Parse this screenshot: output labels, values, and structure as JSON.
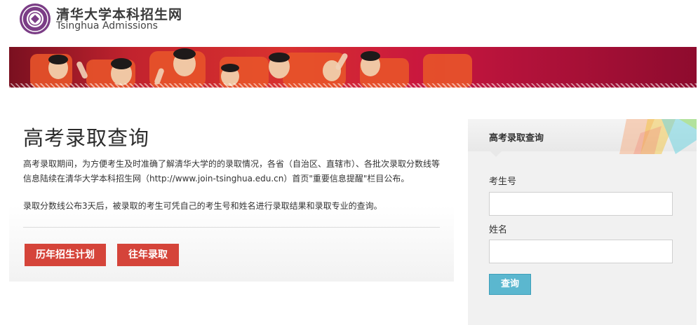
{
  "header": {
    "site_name_cn": "清华大学本科招生网",
    "site_name_en": "Tsinghua Admissions",
    "logo_icon": "tsinghua-seal-icon"
  },
  "banner": {
    "image": "students-cheering-banner",
    "colors": {
      "primary": "#c2232e",
      "dark": "#7a1020"
    }
  },
  "main": {
    "title": "高考录取查询",
    "paragraph1": "高考录取期间，为方便考生及时准确了解清华大学的的录取情况，各省（自治区、直辖市）、各批次录取分数线等信息陆续在清华大学本科招生网（http://www.join-tsinghua.edu.cn）首页\"重要信息提醒\"栏目公布。",
    "paragraph2": "录取分数线公布3天后，被录取的考生可凭自己的考生号和姓名进行录取结果和录取专业的查询。",
    "buttons": {
      "plan_label": "历年招生计划",
      "past_label": "往年录取",
      "color": "#d5443a"
    }
  },
  "panel": {
    "title": "高考录取查询",
    "exam_id_label": "考生号",
    "exam_id_value": "",
    "name_label": "姓名",
    "name_value": "",
    "query_label": "查询",
    "query_color": "#5bb7cf"
  }
}
